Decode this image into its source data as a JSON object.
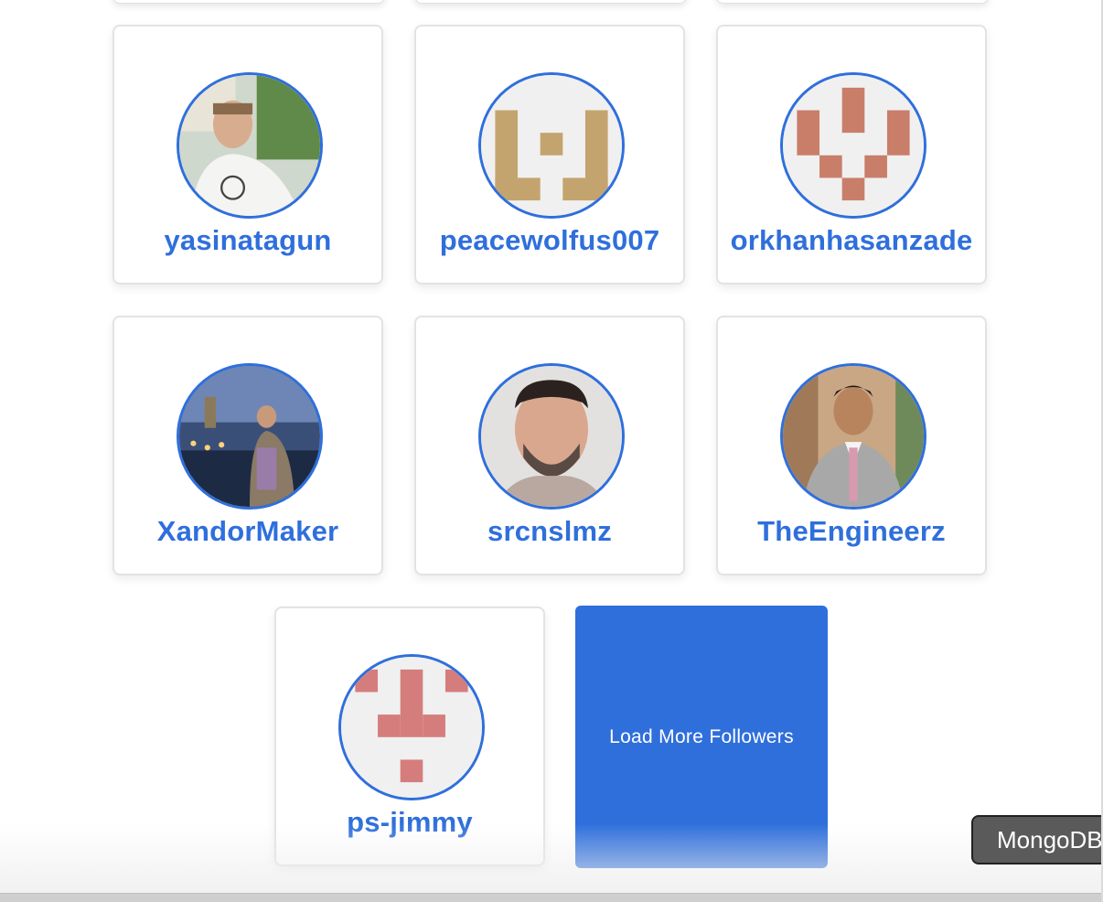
{
  "followers": [
    {
      "username": "yasinatagun",
      "avatar": "photo-avatar"
    },
    {
      "username": "peacewolfus007",
      "avatar": "identicon-avatar"
    },
    {
      "username": "orkhanhasanzade",
      "avatar": "identicon-avatar"
    },
    {
      "username": "XandorMaker",
      "avatar": "photo-avatar"
    },
    {
      "username": "srcnslmz",
      "avatar": "photo-avatar"
    },
    {
      "username": "TheEngineerz",
      "avatar": "photo-avatar"
    },
    {
      "username": "ps-jimmy",
      "avatar": "identicon-avatar"
    }
  ],
  "load_more_label": "Load More Followers",
  "mongo_chip_label": "MongoDB",
  "colors": {
    "accent": "#2f6fdc",
    "identicon_tan": "#c4a46e",
    "identicon_terracotta": "#c97e6a",
    "identicon_rose": "#d57d7d"
  }
}
